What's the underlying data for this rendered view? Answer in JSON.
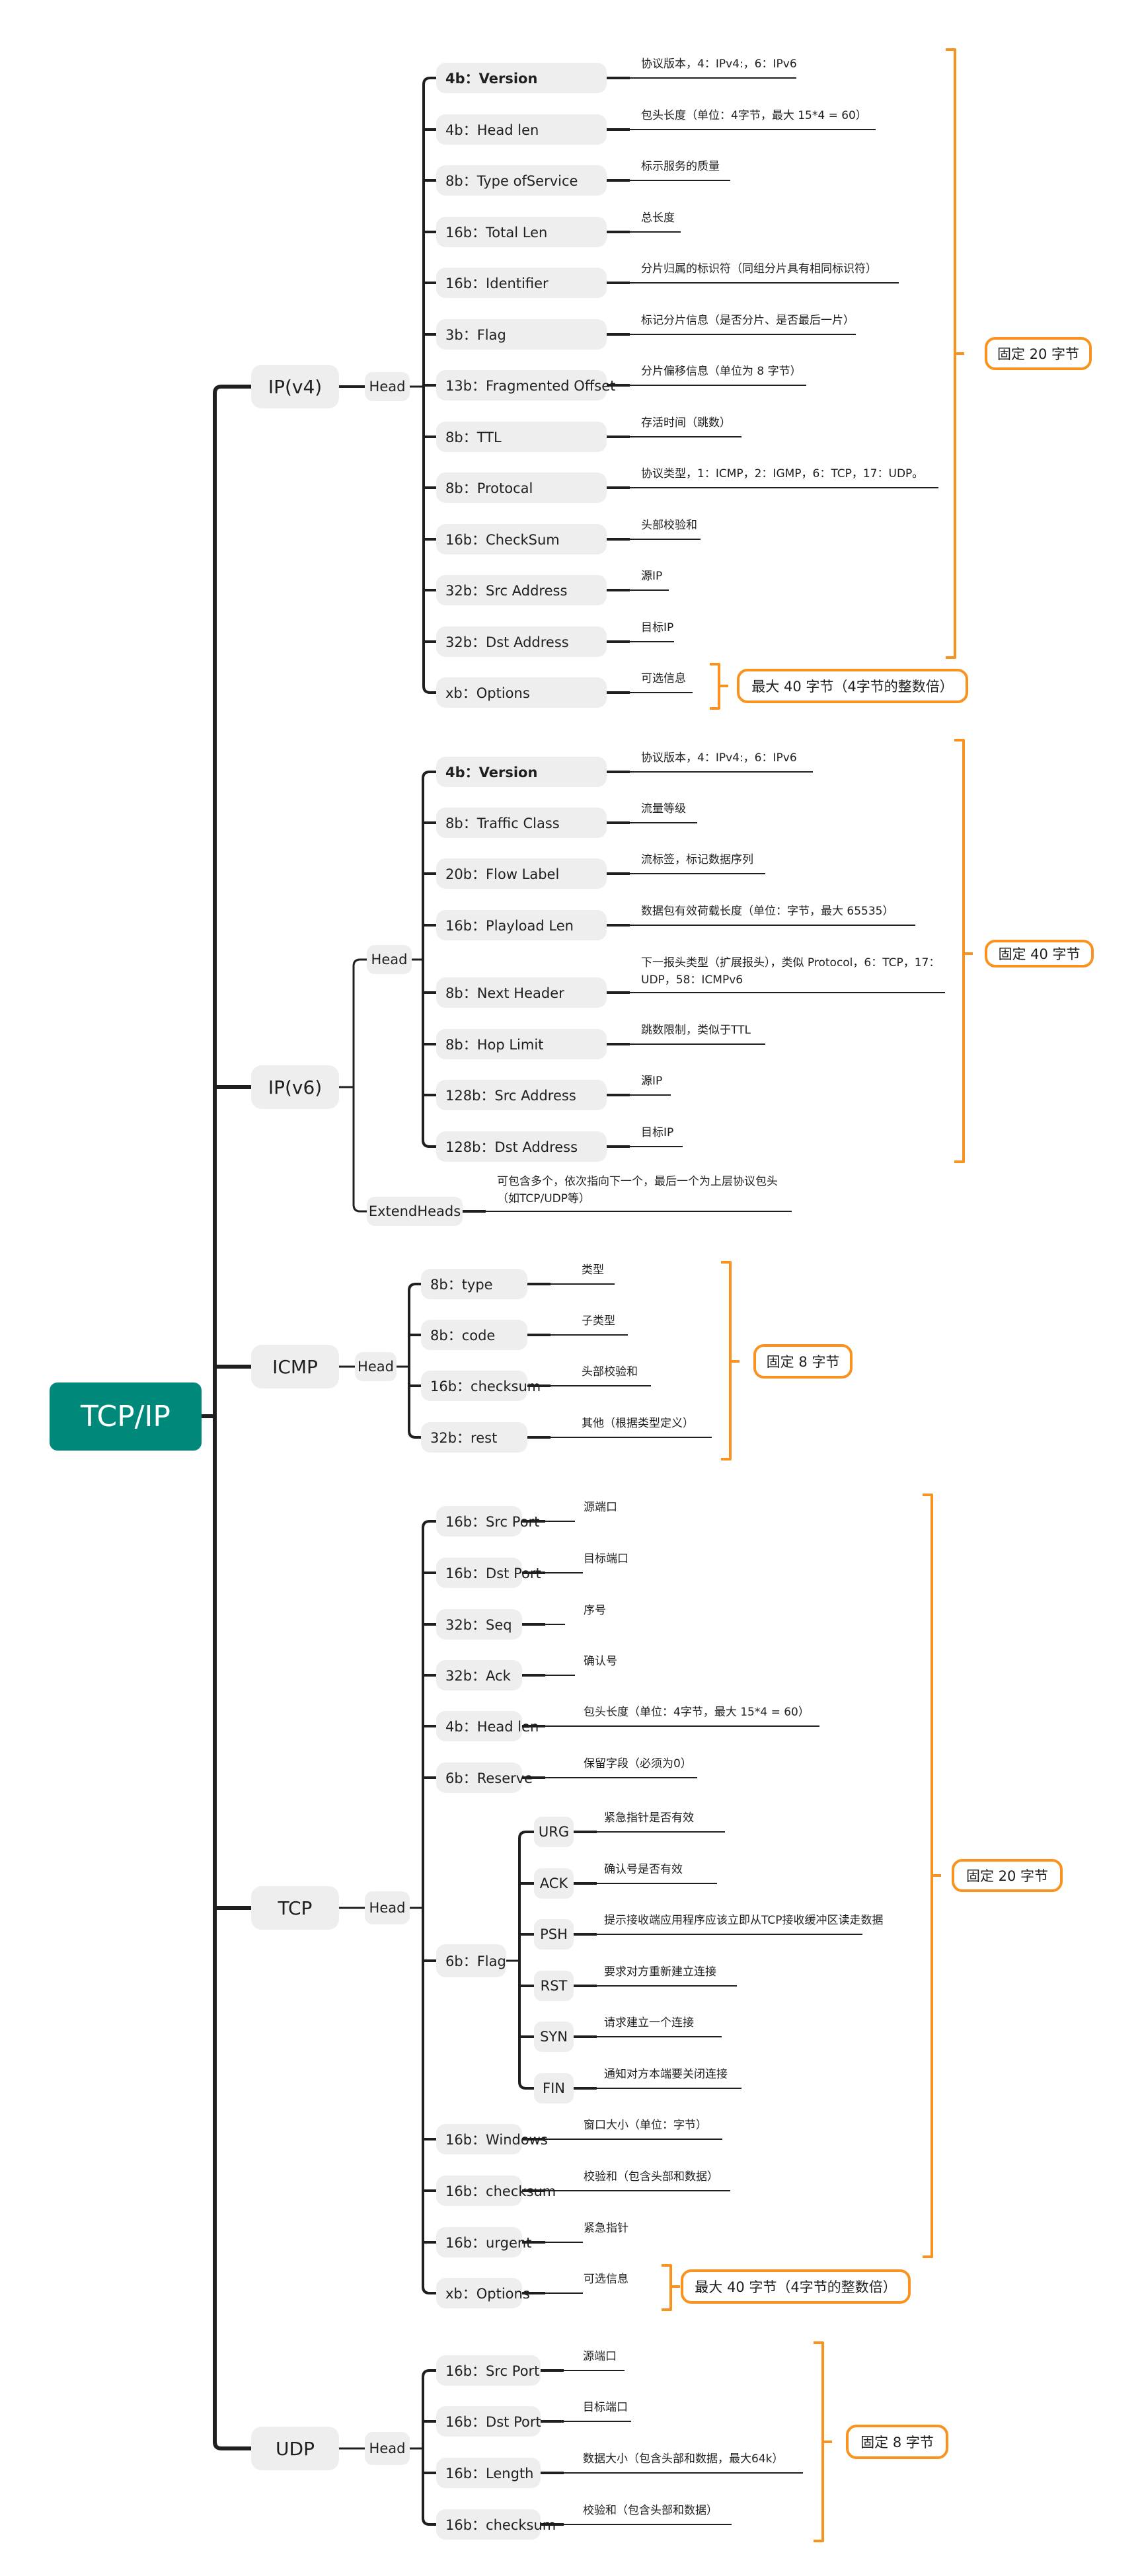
{
  "root": {
    "label": "TCP/IP",
    "color": "#00897b"
  },
  "colors": {
    "line": "#1f1f1f",
    "bracket": "#f7931e",
    "node_bg": "#eeeeee"
  },
  "protocols": {
    "ipv4": {
      "label": "IP(v4)",
      "head_label": "Head",
      "fields": [
        {
          "label": "4b：Version",
          "desc": "协议版本，4：IPv4:，6：IPv6",
          "bold": true
        },
        {
          "label": "4b：Head len",
          "desc": "包头长度（单位：4字节，最大 15*4 = 60）"
        },
        {
          "label": "8b：Type ofService",
          "desc": "标示服务的质量"
        },
        {
          "label": "16b：Total Len",
          "desc": "总长度"
        },
        {
          "label": "16b：Identifier",
          "desc": "分片归属的标识符（同组分片具有相同标识符）"
        },
        {
          "label": "3b：Flag",
          "desc": "标记分片信息（是否分片、是否最后一片）"
        },
        {
          "label": "13b：Fragmented Offset",
          "desc": "分片偏移信息（单位为 8 字节）"
        },
        {
          "label": "8b：TTL",
          "desc": "存活时间（跳数）"
        },
        {
          "label": "8b：Protocal",
          "desc": "协议类型，1：ICMP，2：IGMP，6：TCP，17：UDP。"
        },
        {
          "label": "16b：CheckSum",
          "desc": "头部校验和"
        },
        {
          "label": "32b：Src Address",
          "desc": "源IP"
        },
        {
          "label": "32b：Dst Address",
          "desc": "目标IP"
        },
        {
          "label": "xb：Options",
          "desc": "可选信息"
        }
      ],
      "summary_fixed": "固定 20 字节",
      "summary_options": "最大 40 字节（4字节的整数倍）"
    },
    "ipv6": {
      "label": "IP(v6)",
      "head_label": "Head",
      "fields": [
        {
          "label": "4b：Version",
          "desc": "协议版本，4：IPv4:，6：IPv6",
          "bold": true
        },
        {
          "label": "8b：Traffic Class",
          "desc": "流量等级"
        },
        {
          "label": "20b：Flow Label",
          "desc": "流标签，标记数据序列"
        },
        {
          "label": "16b：Playload Len",
          "desc": "数据包有效荷载长度（单位：字节，最大 65535）"
        },
        {
          "label": "8b：Next Header",
          "desc": "下一报头类型（扩展报头），类似 Protocol，6：TCP，17：UDP，58：ICMPv6"
        },
        {
          "label": "8b：Hop Limit",
          "desc": "跳数限制，类似于TTL"
        },
        {
          "label": "128b：Src Address",
          "desc": "源IP"
        },
        {
          "label": "128b：Dst Address",
          "desc": "目标IP"
        }
      ],
      "extend_label": "ExtendHeads",
      "extend_desc": "可包含多个，依次指向下一个，最后一个为上层协议包头（如TCP/UDP等）",
      "summary_fixed": "固定 40 字节"
    },
    "icmp": {
      "label": "ICMP",
      "head_label": "Head",
      "fields": [
        {
          "label": "8b：type",
          "desc": "类型"
        },
        {
          "label": "8b：code",
          "desc": "子类型"
        },
        {
          "label": "16b：checksum",
          "desc": "头部校验和"
        },
        {
          "label": "32b：rest",
          "desc": "其他（根据类型定义）"
        }
      ],
      "summary_fixed": "固定 8 字节"
    },
    "tcp": {
      "label": "TCP",
      "head_label": "Head",
      "fields": [
        {
          "label": "16b：Src Port",
          "desc": "源端口"
        },
        {
          "label": "16b：Dst Port",
          "desc": "目标端口"
        },
        {
          "label": "32b：Seq",
          "desc": "序号"
        },
        {
          "label": "32b：Ack",
          "desc": "确认号"
        },
        {
          "label": "4b：Head len",
          "desc": "包头长度（单位：4字节，最大 15*4 = 60）"
        },
        {
          "label": "6b：Reserve",
          "desc": "保留字段（必须为0）"
        },
        {
          "label": "6b：Flag",
          "flags": [
            {
              "label": "URG",
              "desc": "紧急指针是否有效"
            },
            {
              "label": "ACK",
              "desc": "确认号是否有效"
            },
            {
              "label": "PSH",
              "desc": "提示接收端应用程序应该立即从TCP接收缓冲区读走数据"
            },
            {
              "label": "RST",
              "desc": "要求对方重新建立连接"
            },
            {
              "label": "SYN",
              "desc": "请求建立一个连接"
            },
            {
              "label": "FIN",
              "desc": "通知对方本端要关闭连接"
            }
          ]
        },
        {
          "label": "16b：Windows",
          "desc": "窗口大小（单位：字节）"
        },
        {
          "label": "16b：checksum",
          "desc": "校验和（包含头部和数据）"
        },
        {
          "label": "16b：urgent",
          "desc": "紧急指针"
        },
        {
          "label": "xb：Options",
          "desc": "可选信息"
        }
      ],
      "summary_fixed": "固定 20 字节",
      "summary_options": "最大 40 字节（4字节的整数倍）"
    },
    "udp": {
      "label": "UDP",
      "head_label": "Head",
      "fields": [
        {
          "label": "16b：Src Port",
          "desc": "源端口"
        },
        {
          "label": "16b：Dst Port",
          "desc": "目标端口"
        },
        {
          "label": "16b：Length",
          "desc": "数据大小（包含头部和数据，最大64k）"
        },
        {
          "label": "16b：checksum",
          "desc": "校验和（包含头部和数据）"
        }
      ],
      "summary_fixed": "固定 8 字节"
    }
  }
}
